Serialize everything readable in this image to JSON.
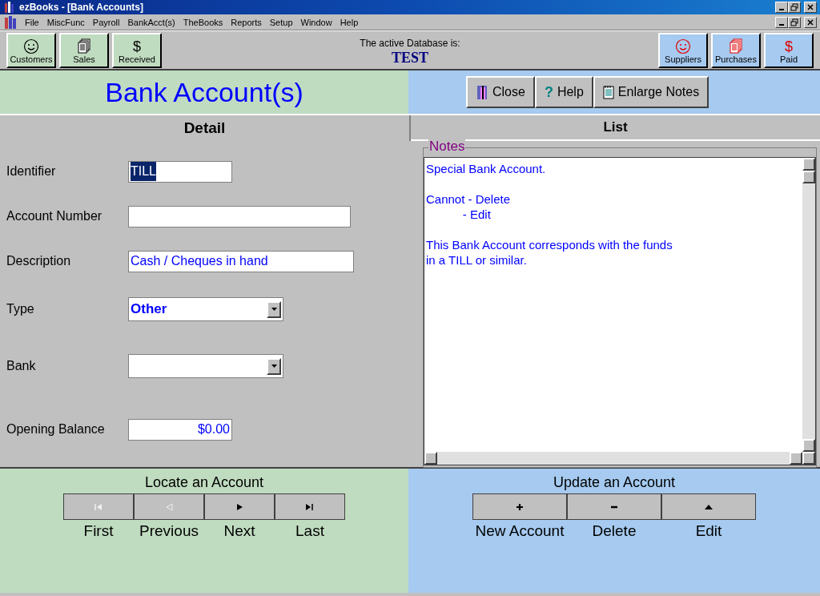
{
  "window": {
    "title": "ezBooks - [Bank Accounts]"
  },
  "menu": [
    "File",
    "MiscFunc",
    "Payroll",
    "BankAcct(s)",
    "TheBooks",
    "Reports",
    "Setup",
    "Window",
    "Help"
  ],
  "toolbar": {
    "left": [
      {
        "label": "Customers",
        "kind": "smiley"
      },
      {
        "label": "Sales",
        "kind": "pages"
      },
      {
        "label": "Received",
        "kind": "symbol",
        "symbol": "$"
      }
    ],
    "database_label": "The active Database is:",
    "database_name": "TEST",
    "right": [
      {
        "label": "Suppliers",
        "kind": "smiley"
      },
      {
        "label": "Purchases",
        "kind": "pages"
      },
      {
        "label": "Paid",
        "kind": "symbol",
        "symbol": "$"
      }
    ]
  },
  "form_title": "Bank Account(s)",
  "actions": [
    {
      "label": "Close",
      "kind": "exit"
    },
    {
      "label": "Help",
      "kind": "symbol",
      "symbol": "?"
    },
    {
      "label": "Enlarge Notes",
      "kind": "notepad"
    }
  ],
  "tabs": [
    {
      "label": "Detail",
      "selected": true
    },
    {
      "label": "List",
      "selected": false
    }
  ],
  "fields": [
    {
      "label": "Identifier",
      "kind": "text",
      "value": "TILL",
      "selected_text": true
    },
    {
      "label": "Account Number",
      "kind": "text"
    },
    {
      "label": "Description",
      "kind": "text",
      "value": "Cash / Cheques in hand",
      "selected_text": false
    },
    {
      "label": "Type",
      "kind": "select",
      "value": "Other",
      "selected_text": false
    },
    {
      "label": "Bank",
      "kind": "select"
    },
    {
      "label": "Opening Balance",
      "kind": "money",
      "value": "$0.00",
      "selected_text": false
    }
  ],
  "notes": {
    "legend": "Notes",
    "paragraphs": [
      "Special Bank Account.",
      "Cannot - Delete\n           - Edit",
      "This Bank Account corresponds with the funds\nin a TILL or similar."
    ]
  },
  "locate": {
    "title": "Locate an Account",
    "buttons": [
      {
        "label": "First",
        "kind": "first",
        "disabled": true
      },
      {
        "label": "Previous",
        "kind": "previous",
        "disabled": true
      },
      {
        "label": "Next",
        "kind": "next",
        "disabled": false
      },
      {
        "label": "Last",
        "kind": "last",
        "disabled": false
      }
    ]
  },
  "update": {
    "title": "Update an Account",
    "buttons": [
      {
        "label": "New Account",
        "kind": "plus"
      },
      {
        "label": "Delete",
        "kind": "minus"
      },
      {
        "label": "Edit",
        "kind": "up"
      }
    ]
  }
}
